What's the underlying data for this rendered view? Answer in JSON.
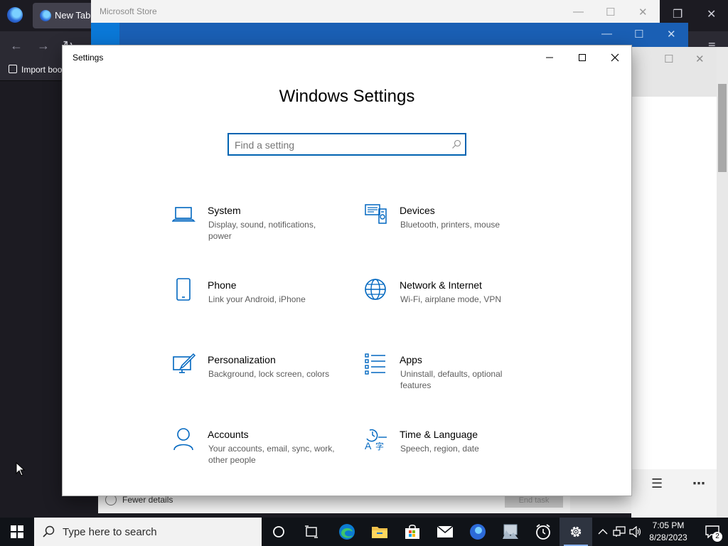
{
  "firefox": {
    "tab_title": "New Tab",
    "import_label": "Import boo"
  },
  "store": {
    "title": "Microsoft Store"
  },
  "task_manager": {
    "fewer_details": "Fewer details",
    "end_task": "End task"
  },
  "settings": {
    "window_title": "Settings",
    "heading": "Windows Settings",
    "search_placeholder": "Find a setting",
    "tiles": [
      {
        "name": "System",
        "desc": "Display, sound, notifications, power",
        "icon": "laptop-icon"
      },
      {
        "name": "Devices",
        "desc": "Bluetooth, printers, mouse",
        "icon": "devices-icon"
      },
      {
        "name": "Phone",
        "desc": "Link your Android, iPhone",
        "icon": "phone-icon"
      },
      {
        "name": "Network & Internet",
        "desc": "Wi-Fi, airplane mode, VPN",
        "icon": "globe-icon"
      },
      {
        "name": "Personalization",
        "desc": "Background, lock screen, colors",
        "icon": "personalization-icon"
      },
      {
        "name": "Apps",
        "desc": "Uninstall, defaults, optional features",
        "icon": "apps-list-icon"
      },
      {
        "name": "Accounts",
        "desc": "Your accounts, email, sync, work, other people",
        "icon": "person-icon"
      },
      {
        "name": "Time & Language",
        "desc": "Speech, region, date",
        "icon": "time-language-icon"
      }
    ]
  },
  "taskbar": {
    "search_placeholder": "Type here to search",
    "time": "7:05 PM",
    "date": "8/28/2023",
    "notification_count": "2"
  },
  "colors": {
    "accent": "#0063b1",
    "icon_blue": "#0067c0",
    "taskbar": "#101318"
  }
}
